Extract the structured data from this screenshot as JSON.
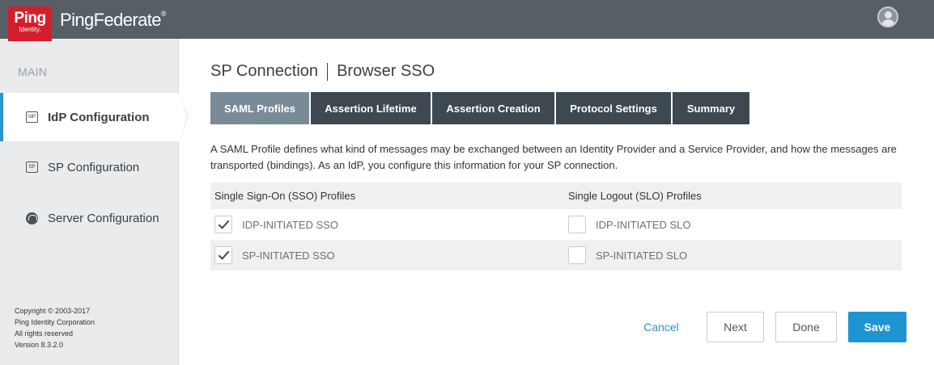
{
  "header": {
    "logo_text": "Ping",
    "logo_sub": "Identity.",
    "product": "PingFederate",
    "product_mark": "®"
  },
  "sidebar": {
    "heading": "MAIN",
    "items": [
      {
        "label": "IdP Configuration",
        "icon_text": "IdP",
        "icon": "idp-icon",
        "active": true
      },
      {
        "label": "SP Configuration",
        "icon_text": "SP",
        "icon": "sp-icon",
        "active": false
      },
      {
        "label": "Server Configuration",
        "icon": "server-icon",
        "active": false
      }
    ],
    "copyright": [
      "Copyright © 2003-2017",
      "Ping Identity Corporation",
      "All rights reserved",
      "Version 8.3.2.0"
    ]
  },
  "page": {
    "title_main": "SP Connection",
    "title_sub": "Browser SSO",
    "tabs": [
      {
        "label": "SAML Profiles",
        "active": true
      },
      {
        "label": "Assertion Lifetime",
        "active": false
      },
      {
        "label": "Assertion Creation",
        "active": false
      },
      {
        "label": "Protocol Settings",
        "active": false
      },
      {
        "label": "Summary",
        "active": false
      }
    ],
    "description": "A SAML Profile defines what kind of messages may be exchanged between an Identity Provider and a Service Provider, and how the messages are transported (bindings). As an IdP, you configure this information for your SP connection."
  },
  "profiles": {
    "sso_header": "Single Sign-On (SSO) Profiles",
    "slo_header": "Single Logout (SLO) Profiles",
    "rows": [
      {
        "sso_label": "IDP-INITIATED SSO",
        "sso_checked": true,
        "slo_label": "IDP-INITIATED SLO",
        "slo_checked": false
      },
      {
        "sso_label": "SP-INITIATED SSO",
        "sso_checked": true,
        "slo_label": "SP-INITIATED SLO",
        "slo_checked": false
      }
    ]
  },
  "actions": {
    "cancel": "Cancel",
    "next": "Next",
    "done": "Done",
    "save": "Save"
  },
  "colors": {
    "accent": "#1e94d0",
    "topbar": "#575f66",
    "logo": "#d51e2d",
    "tab_dark": "#3d4850",
    "tab_active": "#7a8b98"
  }
}
